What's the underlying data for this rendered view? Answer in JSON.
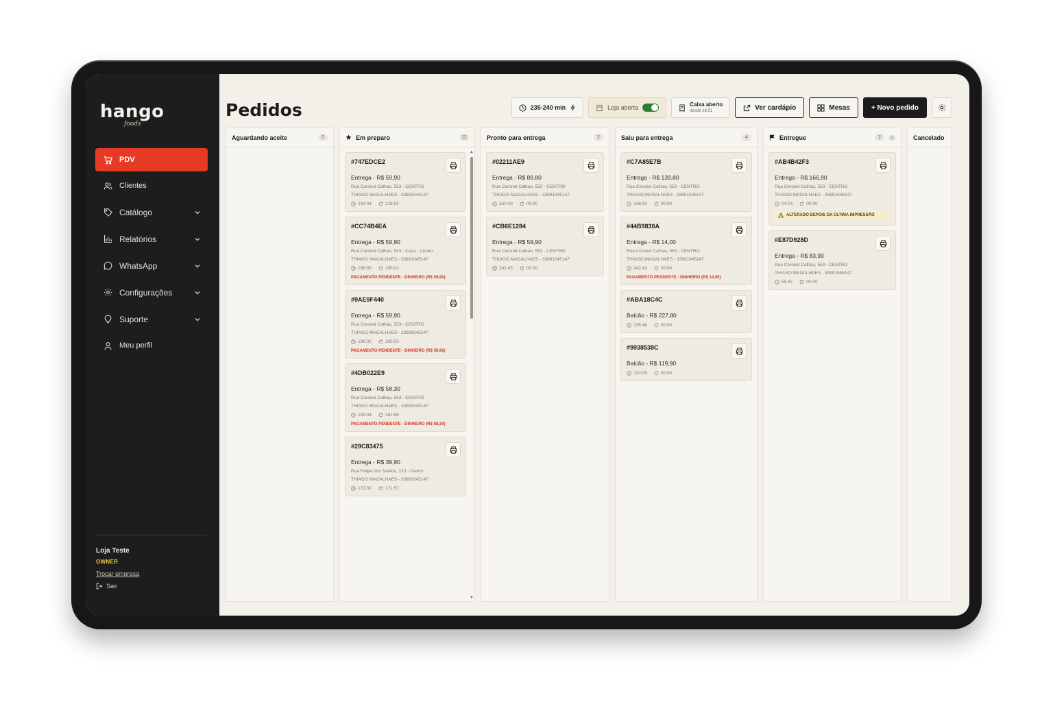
{
  "brand": {
    "logo": "hango",
    "logo_sub": "foods"
  },
  "sidebar": {
    "items": [
      {
        "label": "PDV",
        "icon": "cart-icon",
        "active": true
      },
      {
        "label": "Clientes",
        "icon": "users-icon"
      },
      {
        "label": "Catálogo",
        "icon": "tag-icon",
        "expandable": true
      },
      {
        "label": "Relatórios",
        "icon": "bar-chart-icon",
        "expandable": true
      },
      {
        "label": "WhatsApp",
        "icon": "whatsapp-icon",
        "expandable": true
      },
      {
        "label": "Configurações",
        "icon": "gear-icon",
        "expandable": true
      },
      {
        "label": "Suporte",
        "icon": "lightbulb-icon",
        "expandable": true
      },
      {
        "label": "Meu perfil",
        "icon": "user-icon"
      }
    ],
    "store": {
      "name": "Loja Teste",
      "role": "OWNER",
      "switch_label": "Trocar empresa",
      "exit_label": "Sair"
    }
  },
  "header": {
    "title": "Pedidos",
    "time_estimate": "235-240 min",
    "store_status": "Loja aberta",
    "cashier_title": "Caixa aberto",
    "cashier_since": "desde 18:51",
    "menu_button": "Ver cardápio",
    "tables_button": "Mesas",
    "new_order_button": "+ Novo pedido"
  },
  "columns": [
    {
      "title": "Aguardando aceite",
      "count": "0",
      "cards": []
    },
    {
      "title": "Em preparo",
      "count": "12",
      "icon": "star-icon",
      "cards": [
        {
          "id": "#747EDCE2",
          "line": "Entrega - R$ 59,90",
          "addr": "Rua Coronel Calhau, 553 - CENTRO",
          "cust": "THIAGO MAGALHAES - 33991045147",
          "t1": "242:44",
          "t2": "218:54"
        },
        {
          "id": "#CC74B4EA",
          "line": "Entrega - R$ 59,90",
          "addr": "Rua Coronel Calhau, 543 - Casa - Centro",
          "cust": "THIAGO MAGALHAES - 33991045147",
          "t1": "196:55",
          "t2": "195:03",
          "warn": "PAGAMENTO PENDENTE - DINHEIRO (R$ 59,90)"
        },
        {
          "id": "#9AE9F440",
          "line": "Entrega - R$ 59,90",
          "addr": "Rua Coronel Calhau, 553 - CENTRO",
          "cust": "THIAGO MAGALHAES - 33991045147",
          "t1": "196:02",
          "t2": "195:03",
          "warn": "PAGAMENTO PENDENTE - DINHEIRO (R$ 59,90)"
        },
        {
          "id": "#4DB022E9",
          "line": "Entrega - R$ 58,30",
          "addr": "Rua Coronel Calhau, 553 - CENTRO",
          "cust": "THIAGO MAGALHAES - 33991045147",
          "t1": "195:04",
          "t2": "192:56",
          "warn": "PAGAMENTO PENDENTE - DINHEIRO (R$ 58,30)"
        },
        {
          "id": "#29C83475",
          "line": "Entrega - R$ 39,90",
          "addr": "Rua Felipe dos Santos, 123 - Centro",
          "cust": "THIAGO MAGALHAES - 33991045147",
          "t1": "172:30",
          "t2": "171:57"
        }
      ]
    },
    {
      "title": "Pronto para entrega",
      "count": "2",
      "cards": [
        {
          "id": "#02211AE9",
          "line": "Entrega - R$ 89,80",
          "addr": "Rua Coronel Calhau, 553 - CENTRO",
          "cust": "THIAGO MAGALHAES - 33991045147",
          "t1": "250:49",
          "t2": "00:00"
        },
        {
          "id": "#CB6E1284",
          "line": "Entrega - R$ 59,90",
          "addr": "Rua Coronel Calhau, 553 - CENTRO",
          "cust": "THIAGO MAGALHAES - 33991045147",
          "t1": "242:45",
          "t2": "00:00"
        }
      ]
    },
    {
      "title": "Saiu para entrega",
      "count": "4",
      "cards": [
        {
          "id": "#C7A85E7B",
          "line": "Entrega - R$ 139,80",
          "addr": "Rua Coronel Calhau, 553 - CENTRO",
          "cust": "THIAGO MAGALHAES - 33991045147",
          "t1": "246:50",
          "t2": "00:00"
        },
        {
          "id": "#44B9830A",
          "line": "Entrega - R$ 14,00",
          "addr": "Rua Coronel Calhau, 553 - CENTRO",
          "cust": "THIAGO MAGALHAES - 33991045147",
          "t1": "242:43",
          "t2": "00:00",
          "warn": "PAGAMENTO PENDENTE - DINHEIRO (R$ 14,00)"
        },
        {
          "id": "#ABA18C4C",
          "line": "Balcão - R$ 227,80",
          "t1": "235:46",
          "t2": "00:00"
        },
        {
          "id": "#9938538C",
          "line": "Balcão - R$ 119,90",
          "t1": "220:05",
          "t2": "00:00"
        }
      ]
    },
    {
      "title": "Entregue",
      "count": "2",
      "icon": "flag-icon",
      "gear": true,
      "cards": [
        {
          "id": "#AB4B42F3",
          "line": "Entrega - R$ 166,90",
          "addr": "Rua Coronel Calhau, 553 - CENTRO",
          "cust": "THIAGO MAGALHAES - 33991045147",
          "t1": "04:04",
          "t2": "00:00",
          "alert": "ALTERADO DEPOIS DA ÚLTIMA IMPRESSÃO"
        },
        {
          "id": "#E87D928D",
          "line": "Entrega - R$ 83,90",
          "addr": "Rua Coronel Calhau, 553 - CENTRO",
          "cust": "THIAGO MAGALHAES - 33991045147",
          "t1": "55:47",
          "t2": "00:00"
        }
      ]
    },
    {
      "title": "Cancelado",
      "count": "",
      "cards": []
    }
  ],
  "colors": {
    "accent": "#e63a24",
    "sidebar": "#1d1d1d",
    "background": "#f3f0e9",
    "warning": "#d0341f",
    "toggle_on": "#2e7d32"
  }
}
